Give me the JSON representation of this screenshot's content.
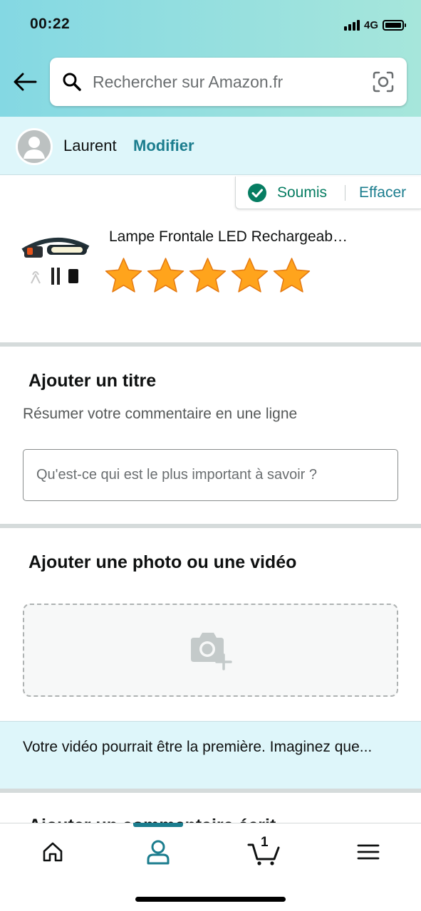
{
  "status_bar": {
    "time": "00:22",
    "network": "4G"
  },
  "search": {
    "placeholder": "Rechercher sur Amazon.fr"
  },
  "profile": {
    "name": "Laurent",
    "edit_label": "Modifier"
  },
  "submission": {
    "status_label": "Soumis",
    "clear_label": "Effacer"
  },
  "product": {
    "title": "Lampe Frontale LED Rechargeab…",
    "rating": 5,
    "max_rating": 5
  },
  "title_section": {
    "heading": "Ajouter un titre",
    "subheading": "Résumer votre commentaire en une ligne",
    "input_placeholder": "Qu'est-ce qui est le plus important à savoir ?"
  },
  "media_section": {
    "heading": "Ajouter une photo ou une vidéo"
  },
  "video_banner": {
    "text": "Votre vidéo pourrait être la première. Imaginez que..."
  },
  "next_section": {
    "heading": "Ajouter un commentaire écrit"
  },
  "bottom_nav": {
    "items": [
      "home-icon",
      "account-icon",
      "cart-icon",
      "menu-icon"
    ],
    "active": "account-icon",
    "cart_count": "1"
  },
  "colors": {
    "accent": "#1b7d8e",
    "success": "#067d62",
    "star": "#ffa41c",
    "banner": "#def6fa"
  }
}
